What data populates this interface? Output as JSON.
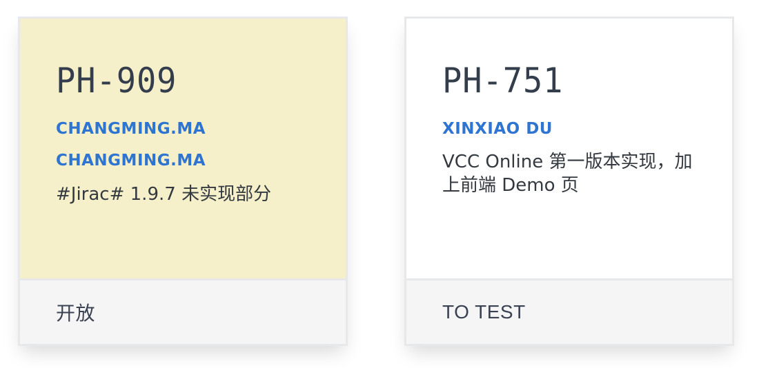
{
  "cards": [
    {
      "id": "PH-909",
      "assignees": [
        "CHANGMING.MA",
        "CHANGMING.MA"
      ],
      "summary": "#Jirac# 1.9.7 未实现部分",
      "status": "开放",
      "background": "#f5f0ca"
    },
    {
      "id": "PH-751",
      "assignees": [
        "XINXIAO DU"
      ],
      "summary": "VCC Online 第一版本实现，加上前端 Demo 页",
      "status": "TO TEST",
      "background": "#ffffff"
    }
  ],
  "colors": {
    "id_text": "#343d4c",
    "assignee_link": "#2e74d1",
    "footer_bg": "#f5f5f6",
    "border": "#e7e8ea"
  }
}
